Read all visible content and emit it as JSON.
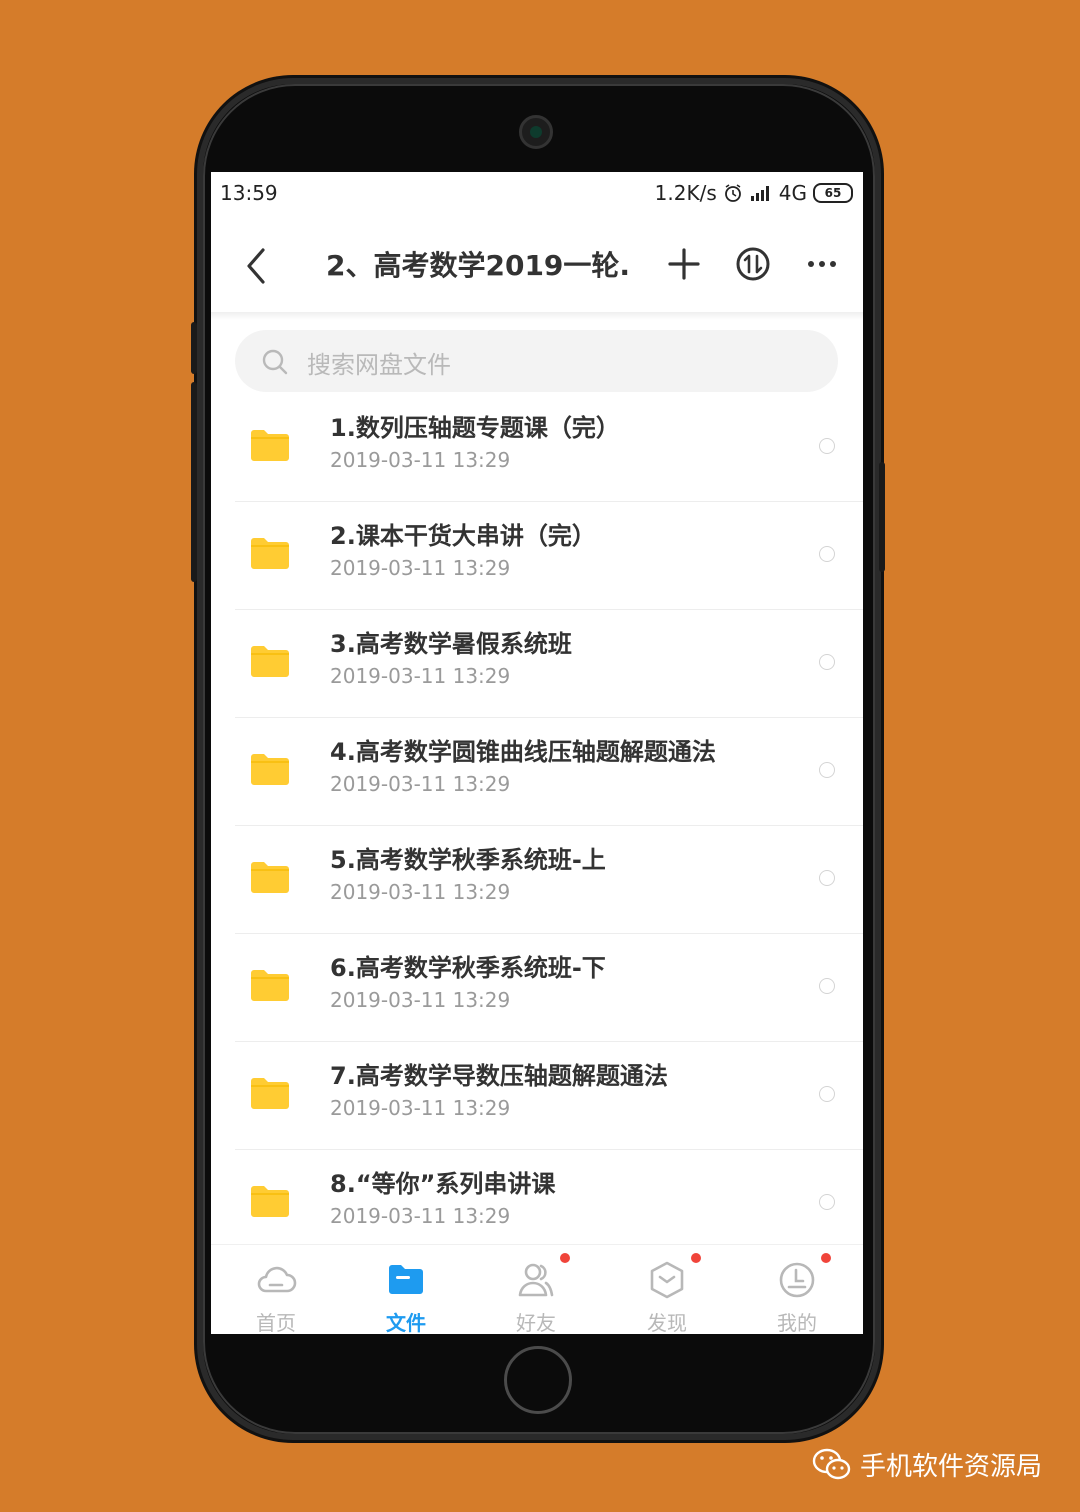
{
  "status": {
    "time": "13:59",
    "speed": "1.2K/s",
    "network": "4G",
    "battery": "65"
  },
  "header": {
    "title": "2、高考数学2019一轮..."
  },
  "search": {
    "placeholder": "搜索网盘文件"
  },
  "files": [
    {
      "name": "1.数列压轴题专题课（完）",
      "date": "2019-03-11  13:29"
    },
    {
      "name": "2.课本干货大串讲（完）",
      "date": "2019-03-11  13:29"
    },
    {
      "name": "3.高考数学暑假系统班",
      "date": "2019-03-11  13:29"
    },
    {
      "name": "4.高考数学圆锥曲线压轴题解题通法",
      "date": "2019-03-11  13:29"
    },
    {
      "name": "5.高考数学秋季系统班-上",
      "date": "2019-03-11  13:29"
    },
    {
      "name": "6.高考数学秋季系统班-下",
      "date": "2019-03-11  13:29"
    },
    {
      "name": "7.高考数学导数压轴题解题通法",
      "date": "2019-03-11  13:29"
    },
    {
      "name": "8.“等你”系列串讲课",
      "date": "2019-03-11  13:29"
    }
  ],
  "tabs": [
    {
      "label": "首页",
      "icon": "cloud-icon"
    },
    {
      "label": "文件",
      "icon": "folder-icon",
      "active": true
    },
    {
      "label": "好友",
      "icon": "friends-icon"
    },
    {
      "label": "发现",
      "icon": "discover-icon"
    },
    {
      "label": "我的",
      "icon": "profile-icon"
    }
  ],
  "watermark": {
    "text": "手机软件资源局"
  },
  "colors": {
    "background": "#D57C2A",
    "accent": "#1e9bf0",
    "folder": "#FFCC33",
    "badge": "#f0443a"
  }
}
